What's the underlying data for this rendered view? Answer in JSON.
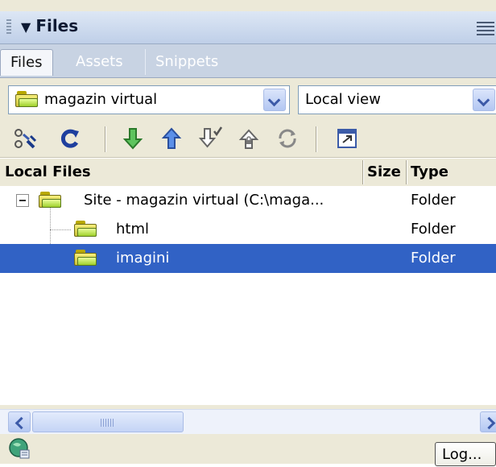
{
  "panel": {
    "title": "Files"
  },
  "tabs": [
    {
      "label": "Files",
      "active": true
    },
    {
      "label": "Assets",
      "active": false
    },
    {
      "label": "Snippets",
      "active": false
    }
  ],
  "site_select": {
    "value": "magazin virtual"
  },
  "view_select": {
    "value": "Local view"
  },
  "toolbar": {
    "buttons": [
      {
        "icon": "connect-icon"
      },
      {
        "icon": "refresh-icon"
      },
      {
        "icon": "get-files-icon"
      },
      {
        "icon": "put-files-icon"
      },
      {
        "icon": "check-out-icon"
      },
      {
        "icon": "check-in-icon"
      },
      {
        "icon": "synchronize-icon"
      },
      {
        "icon": "expand-collapse-icon"
      }
    ]
  },
  "columns": {
    "name": "Local Files",
    "size": "Size",
    "type": "Type"
  },
  "tree": [
    {
      "name": "Site - magazin virtual (C:\\maga...",
      "type": "Folder",
      "level": 0,
      "expanded": true,
      "selected": false
    },
    {
      "name": "html",
      "type": "Folder",
      "level": 1,
      "selected": false
    },
    {
      "name": "imagini",
      "type": "Folder",
      "level": 1,
      "selected": true
    }
  ],
  "status": {
    "log_label": "Log..."
  },
  "colors": {
    "selection": "#3162c5",
    "panel_bg": "#ece9d8",
    "header_bg": "#c8d3e3"
  }
}
